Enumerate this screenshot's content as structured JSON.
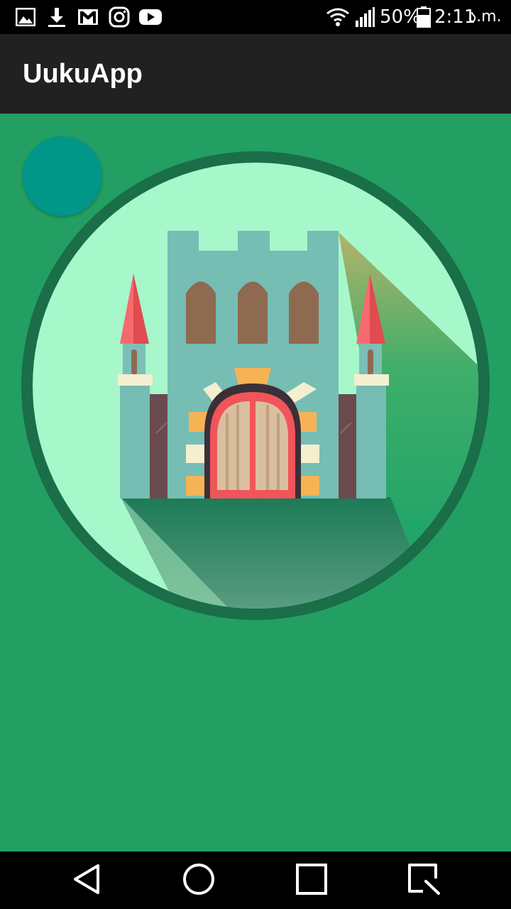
{
  "status_bar": {
    "icons": [
      "gallery-icon",
      "download-icon",
      "gmail-icon",
      "instagram-icon",
      "youtube-icon",
      "wifi-icon",
      "signal-icon",
      "battery-icon"
    ],
    "battery_percent": "50%",
    "time": "2:11",
    "ampm": "ა.m."
  },
  "app_bar": {
    "title": "UukuApp"
  },
  "colors": {
    "background": "#239f63",
    "app_bar": "#212121",
    "fab": "#009688",
    "circle_border": "#1a6e48",
    "circle_fill": "#a6f8cb"
  },
  "content": {
    "illustration": "castle-illustration",
    "fab_icon": "fab-circle"
  },
  "nav_bar": {
    "buttons": [
      "back-icon",
      "home-icon",
      "recents-icon",
      "screenshot-icon"
    ]
  }
}
